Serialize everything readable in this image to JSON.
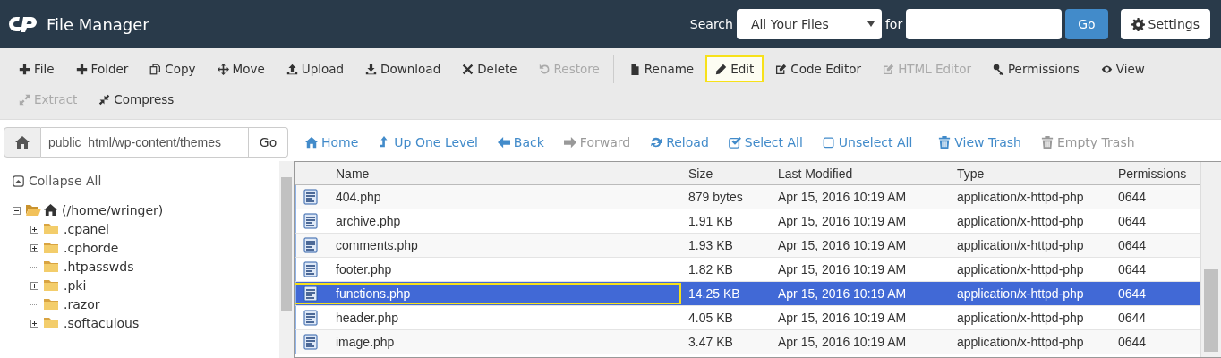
{
  "header": {
    "title": "File Manager",
    "search_label": "Search",
    "search_scope": "All Your Files",
    "for_label": "for",
    "go_label": "Go",
    "settings_label": "Settings"
  },
  "toolbar": {
    "rows": [
      {
        "groups": [
          [
            {
              "label": "File",
              "disabled": false,
              "highlighted": false
            },
            {
              "label": "Folder",
              "disabled": false,
              "highlighted": false
            },
            {
              "label": "Copy",
              "disabled": false,
              "highlighted": false
            },
            {
              "label": "Move",
              "disabled": false,
              "highlighted": false
            },
            {
              "label": "Upload",
              "disabled": false,
              "highlighted": false
            },
            {
              "label": "Download",
              "disabled": false,
              "highlighted": false
            },
            {
              "label": "Delete",
              "disabled": false,
              "highlighted": false
            },
            {
              "label": "Restore",
              "disabled": true,
              "highlighted": false
            }
          ],
          [
            {
              "label": "Rename",
              "disabled": false,
              "highlighted": false
            },
            {
              "label": "Edit",
              "disabled": false,
              "highlighted": true
            },
            {
              "label": "Code Editor",
              "disabled": false,
              "highlighted": false
            },
            {
              "label": "HTML Editor",
              "disabled": true,
              "highlighted": false
            },
            {
              "label": "Permissions",
              "disabled": false,
              "highlighted": false
            },
            {
              "label": "View",
              "disabled": false,
              "highlighted": false
            }
          ]
        ]
      },
      {
        "groups": [
          [
            {
              "label": "Extract",
              "disabled": true,
              "highlighted": false
            },
            {
              "label": "Compress",
              "disabled": false,
              "highlighted": false
            }
          ]
        ]
      }
    ]
  },
  "path_bar": {
    "value": "public_html/wp-content/themes",
    "go_label": "Go"
  },
  "tree": {
    "collapse_label": "Collapse All",
    "items": [
      {
        "label": "(/home/wringer)",
        "expanded": true,
        "children": [
          {
            "label": ".cpanel",
            "expanded": false,
            "has_children": true
          },
          {
            "label": ".cphorde",
            "expanded": false,
            "has_children": true
          },
          {
            "label": ".htpasswds",
            "expanded": false,
            "has_children": false
          },
          {
            "label": ".pki",
            "expanded": false,
            "has_children": true
          },
          {
            "label": ".razor",
            "expanded": false,
            "has_children": false
          },
          {
            "label": ".softaculous",
            "expanded": false,
            "has_children": true
          }
        ]
      }
    ]
  },
  "nav": {
    "groups": [
      [
        {
          "label": "Home",
          "disabled": false
        },
        {
          "label": "Up One Level",
          "disabled": false
        },
        {
          "label": "Back",
          "disabled": false
        },
        {
          "label": "Forward",
          "disabled": true
        },
        {
          "label": "Reload",
          "disabled": false
        },
        {
          "label": "Select All",
          "disabled": false
        },
        {
          "label": "Unselect All",
          "disabled": false
        }
      ],
      [
        {
          "label": "View Trash",
          "disabled": false
        },
        {
          "label": "Empty Trash",
          "disabled": true
        }
      ]
    ]
  },
  "table": {
    "columns": [
      "Name",
      "Size",
      "Last Modified",
      "Type",
      "Permissions"
    ],
    "rows": [
      {
        "name": "404.php",
        "size": "879 bytes",
        "modified": "Apr 15, 2016 10:19 AM",
        "type": "application/x-httpd-php",
        "permissions": "0644",
        "selected": false,
        "highlighted": false
      },
      {
        "name": "archive.php",
        "size": "1.91 KB",
        "modified": "Apr 15, 2016 10:19 AM",
        "type": "application/x-httpd-php",
        "permissions": "0644",
        "selected": false,
        "highlighted": false
      },
      {
        "name": "comments.php",
        "size": "1.93 KB",
        "modified": "Apr 15, 2016 10:19 AM",
        "type": "application/x-httpd-php",
        "permissions": "0644",
        "selected": false,
        "highlighted": false
      },
      {
        "name": "footer.php",
        "size": "1.82 KB",
        "modified": "Apr 15, 2016 10:19 AM",
        "type": "application/x-httpd-php",
        "permissions": "0644",
        "selected": false,
        "highlighted": false
      },
      {
        "name": "functions.php",
        "size": "14.25 KB",
        "modified": "Apr 15, 2016 10:19 AM",
        "type": "application/x-httpd-php",
        "permissions": "0644",
        "selected": true,
        "highlighted": true
      },
      {
        "name": "header.php",
        "size": "4.05 KB",
        "modified": "Apr 15, 2016 10:19 AM",
        "type": "application/x-httpd-php",
        "permissions": "0644",
        "selected": false,
        "highlighted": false
      },
      {
        "name": "image.php",
        "size": "3.47 KB",
        "modified": "Apr 15, 2016 10:19 AM",
        "type": "application/x-httpd-php",
        "permissions": "0644",
        "selected": false,
        "highlighted": false
      }
    ]
  }
}
